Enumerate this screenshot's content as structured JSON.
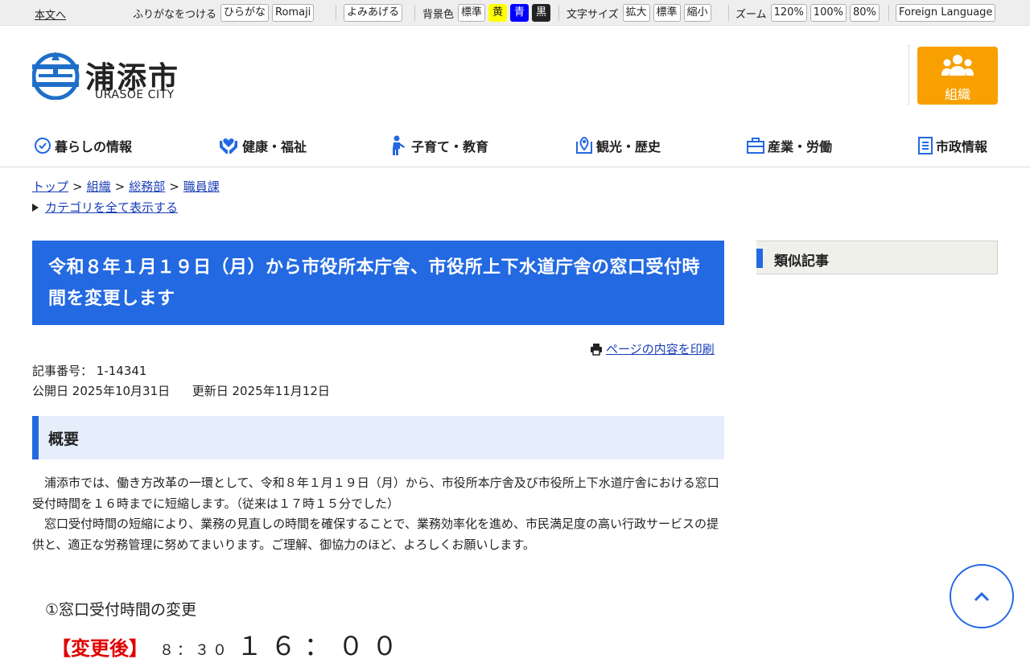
{
  "util": {
    "skip": "本文へ",
    "furigana_label": "ふりがなをつける",
    "hiragana": "ひらがな",
    "romaji": "Romaji",
    "read_aloud": "よみあげる",
    "bg_label": "背景色",
    "bg_standard": "標準",
    "bg_yellow": "黄",
    "bg_blue": "青",
    "bg_black": "黒",
    "font_label": "文字サイズ",
    "font_large": "拡大",
    "font_standard": "標準",
    "font_small": "縮小",
    "zoom_label": "ズーム",
    "zoom_120": "120%",
    "zoom_100": "100%",
    "zoom_80": "80%",
    "foreign": "Foreign Language"
  },
  "header": {
    "logo_jp": "浦添市",
    "logo_en": "URASOE CITY",
    "org_label": "組織"
  },
  "nav": [
    {
      "label": "暮らしの情報",
      "icon": "clock-icon"
    },
    {
      "label": "健康・福祉",
      "icon": "heart-hands-icon"
    },
    {
      "label": "子育て・教育",
      "icon": "child-icon"
    },
    {
      "label": "観光・歴史",
      "icon": "map-pin-icon"
    },
    {
      "label": "産業・労働",
      "icon": "briefcase-icon"
    },
    {
      "label": "市政情報",
      "icon": "document-icon"
    }
  ],
  "breadcrumb": {
    "top": "トップ",
    "org": "組織",
    "dept": "総務部",
    "section": "職員課",
    "sep": ">",
    "show_all": "カテゴリを全て表示する"
  },
  "article": {
    "title": "令和８年１月１９日（月）から市役所本庁舎、市役所上下水道庁舎の窓口受付時間を変更します",
    "print": "ページの内容を印刷",
    "article_no_label": "記事番号：",
    "article_no": "1-14341",
    "published_label": "公開日",
    "published": "2025年10月31日",
    "updated_label": "更新日",
    "updated": "2025年11月12日",
    "overview_heading": "概要",
    "para1": "浦添市では、働き方改革の一環として、令和８年１月１９日（月）から、市役所本庁舎及び市役所上下水道庁舎における窓口受付時間を１６時までに短縮します。（従来は１７時１５分でした）",
    "para2": "窓口受付時間の短縮により、業務の見直しの時間を確保することで、業務効率化を進め、市民満足度の高い行政サービスの提供と、適正な労務管理に努めてまいります。ご理解、御協力のほど、よろしくお願いします。",
    "sub_heading": "①窓口受付時間の変更",
    "after_label": "【変更後】",
    "after_start": "８：３０",
    "after_end": "１６：００"
  },
  "side": {
    "similar": "類似記事"
  }
}
